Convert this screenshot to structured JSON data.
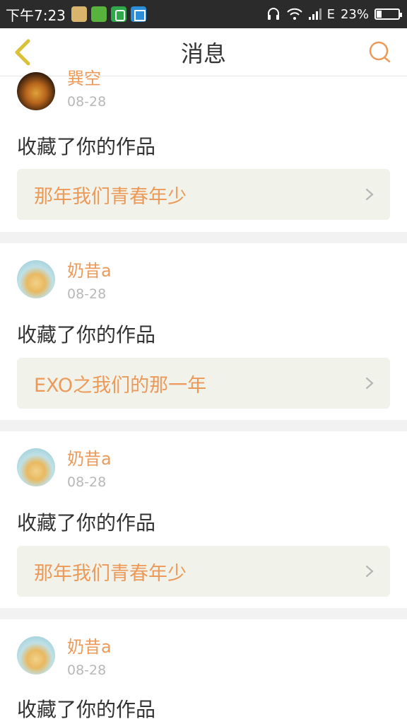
{
  "status_bar": {
    "time": "下午7:23",
    "network": "E",
    "battery_percent": "23%",
    "battery_level": 0.23,
    "icons": [
      "app-icon",
      "message-app-icon",
      "security-app-icon",
      "scanner-app-icon",
      "headphones-icon",
      "wifi-icon",
      "signal-icon",
      "battery-icon"
    ]
  },
  "header": {
    "title": "消息",
    "back_icon": "chevron-left-icon",
    "search_icon": "search-icon"
  },
  "colors": {
    "accent": "#ec9a5a",
    "back_arrow": "#d9c23a",
    "text": "#333333",
    "date": "#b8b8b8",
    "link_bg": "#f1f2ea"
  },
  "messages": [
    {
      "username": "巽空",
      "date": "08-28",
      "action": "收藏了你的作品",
      "work_title": "那年我们青春年少"
    },
    {
      "username": "奶昔a",
      "date": "08-28",
      "action": "收藏了你的作品",
      "work_title": "EXO之我们的那一年"
    },
    {
      "username": "奶昔a",
      "date": "08-28",
      "action": "收藏了你的作品",
      "work_title": "那年我们青春年少"
    },
    {
      "username": "奶昔a",
      "date": "08-28",
      "action": "收藏了你的作品"
    }
  ]
}
